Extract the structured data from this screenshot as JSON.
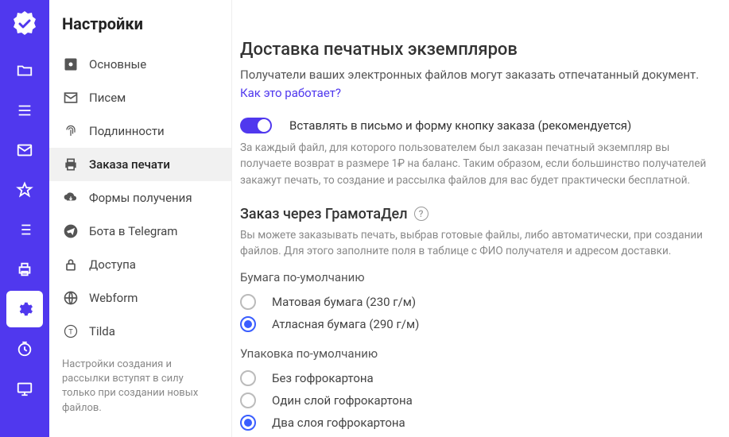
{
  "iconbar": {
    "items": [
      "logo",
      "folder",
      "menu",
      "mail",
      "star",
      "list",
      "print",
      "settings",
      "clock",
      "desktop"
    ],
    "active_index": 7
  },
  "sidebar": {
    "title": "Настройки",
    "items": [
      {
        "label": "Основные"
      },
      {
        "label": "Писем"
      },
      {
        "label": "Подлинности"
      },
      {
        "label": "Заказа печати"
      },
      {
        "label": "Формы получения"
      },
      {
        "label": "Бота в Telegram"
      },
      {
        "label": "Доступа"
      },
      {
        "label": "Webform"
      },
      {
        "label": "Tilda"
      }
    ],
    "active_index": 3,
    "note": "Настройки создания и рассылки вступят в силу только при создании новых файлов."
  },
  "content": {
    "heading": "Доставка печатных экземпляров",
    "intro": "Получатели ваших электронных файлов могут заказать отпечатанный документ.",
    "how_link": "Как это работает?",
    "toggle": {
      "on": true,
      "label": "Вставлять в письмо и форму кнопку заказа (рекомендуется)"
    },
    "toggle_helper": "За каждый файл, для которого пользователем был заказан печатный экземпляр вы получаете возврат в размере 1₽ на баланс. Таким образом, если большинство получателей закажут печать, то создание и рассылка файлов для вас будет практически бесплатной.",
    "order_heading": "Заказ через ГрамотаДел",
    "order_desc": "Вы можете заказывать печать, выбрав готовые файлы, либо автоматически, при создании файлов. Для этого заполните поля в таблице с ФИО получателя и адресом доставки.",
    "paper": {
      "label": "Бумага по-умолчанию",
      "options": [
        {
          "label": "Матовая бумага (230 г/м)",
          "checked": false
        },
        {
          "label": "Атласная бумага (290 г/м)",
          "checked": true
        }
      ]
    },
    "packaging": {
      "label": "Упаковка по-умолчанию",
      "options": [
        {
          "label": "Без гофрокартона",
          "checked": false
        },
        {
          "label": "Один слой гофрокартона",
          "checked": false
        },
        {
          "label": "Два слоя гофрокартона",
          "checked": true
        }
      ]
    }
  }
}
